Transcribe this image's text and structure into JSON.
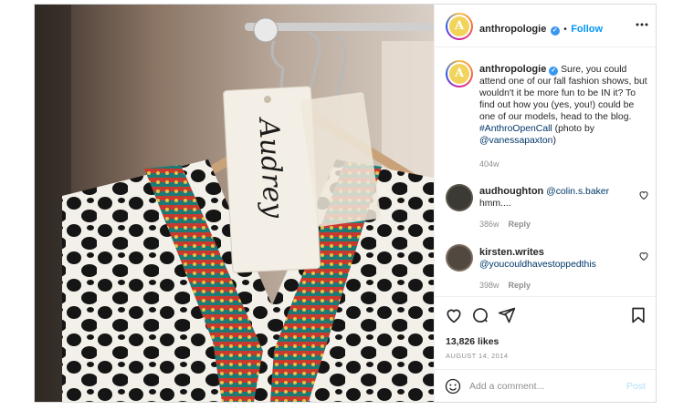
{
  "header": {
    "username": "anthropologie",
    "avatar_letter": "A",
    "separator": "•",
    "follow_label": "Follow"
  },
  "photo": {
    "tag_text": "Audrey",
    "description_icon": "clothing-rack-photo"
  },
  "caption": {
    "username": "anthropologie",
    "text": "Sure, you could attend one of our fall fashion shows, but wouldn't it be more fun to be IN it? To find out how you (yes, you!) could be one of our models, head to the blog.",
    "hashtag": "#AnthroOpenCall",
    "credit_prefix": "(photo by",
    "credit_handle": "@vanessapaxton",
    "credit_suffix": ")",
    "age": "404w"
  },
  "comments": [
    {
      "username": "audhoughton",
      "mention": "@colin.s.baker",
      "text": "hmm....",
      "age": "386w",
      "reply_label": "Reply"
    },
    {
      "username": "kirsten.writes",
      "mention": "@youcouldhavestoppedthis",
      "text": "",
      "age": "398w",
      "reply_label": "Reply"
    }
  ],
  "actions": {
    "likes": "13,826 likes",
    "date": "AUGUST 14, 2014"
  },
  "add_comment": {
    "placeholder": "Add a comment...",
    "post_label": "Post"
  },
  "colors": {
    "accent": "#0095f6",
    "verified": "#3897f0",
    "link": "#00376b",
    "muted": "#8e8e8e"
  }
}
